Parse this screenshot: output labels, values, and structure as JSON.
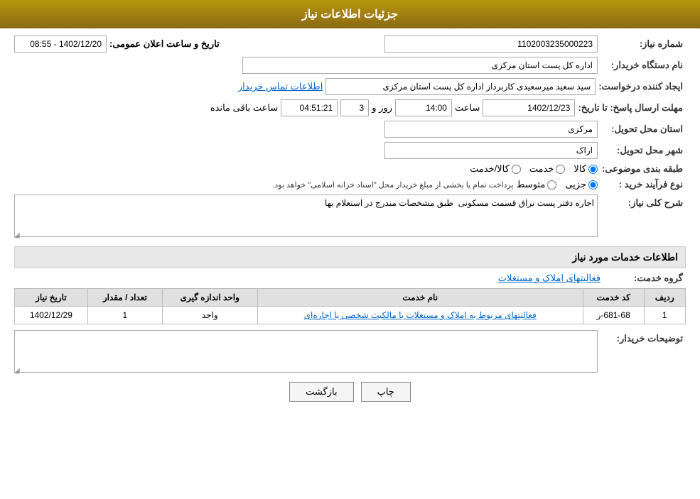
{
  "header": {
    "title": "جزئیات اطلاعات نیاز"
  },
  "fields": {
    "needNumber": {
      "label": "شماره نیاز:",
      "value": "1102003235000223"
    },
    "announcement": {
      "label": "تاریخ و ساعت اعلان عمومی:",
      "value": "1402/12/20 - 08:55"
    },
    "buyerOrg": {
      "label": "نام دستگاه خریدار:",
      "value": "اداره کل پست استان مرکزی"
    },
    "creator": {
      "label": "ایجاد کننده درخواست:",
      "value": "سید سعید میرسعیدی کاربرداز اداره کل پست استان مرکزی"
    },
    "creatorContact": {
      "linkText": "اطلاعات تماس خریدار"
    },
    "deadline": {
      "label": "مهلت ارسال پاسخ: تا تاریخ:",
      "date": "1402/12/23",
      "timeLabel": "ساعت",
      "time": "14:00",
      "dayLabel": "روز و",
      "days": "3",
      "remainLabel": "ساعت باقی مانده",
      "remain": "04:51:21"
    },
    "deliveryProvince": {
      "label": "استان محل تحویل:",
      "value": "مرکزی"
    },
    "deliveryCity": {
      "label": "شهر محل تحویل:",
      "value": "اراک"
    },
    "category": {
      "label": "طبقه بندی موضوعی:",
      "options": [
        "کالا",
        "خدمت",
        "کالا/خدمت"
      ],
      "selected": "کالا"
    },
    "purchaseType": {
      "label": "نوع فرآیند خرید :",
      "options": [
        "جزیی",
        "متوسط"
      ],
      "selected": "جزیی",
      "note": "پرداخت تمام یا بخشی از مبلغ خریدار محل \"اسناد خزانه اسلامی\" خواهد بود."
    },
    "description": {
      "label": "شرح کلی نیاز:",
      "value": "اجاره دفتر پست نراق قسمت مسکونی  طبق مشخصات مندرج در استعلام بها"
    }
  },
  "servicesSection": {
    "title": "اطلاعات خدمات مورد نیاز",
    "serviceGroupLabel": "گروه خدمت:",
    "serviceGroupValue": "فعالیتهای  املاک و مستغلات",
    "tableHeaders": [
      "ردیف",
      "کد خدمت",
      "نام خدمت",
      "واحد اندازه گیری",
      "تعداد / مقدار",
      "تاریخ نیاز"
    ],
    "tableRows": [
      {
        "row": "1",
        "code": "681-68-ر",
        "name": "فعالیتهای مربوط به املاک و مستغلات با مالکیت شخصی یا اجاره‌ای",
        "unit": "واحد",
        "quantity": "1",
        "date": "1402/12/29"
      }
    ]
  },
  "buyerNotes": {
    "label": "توضیحات خریدار:",
    "value": ""
  },
  "buttons": {
    "print": "چاپ",
    "back": "بازگشت"
  }
}
